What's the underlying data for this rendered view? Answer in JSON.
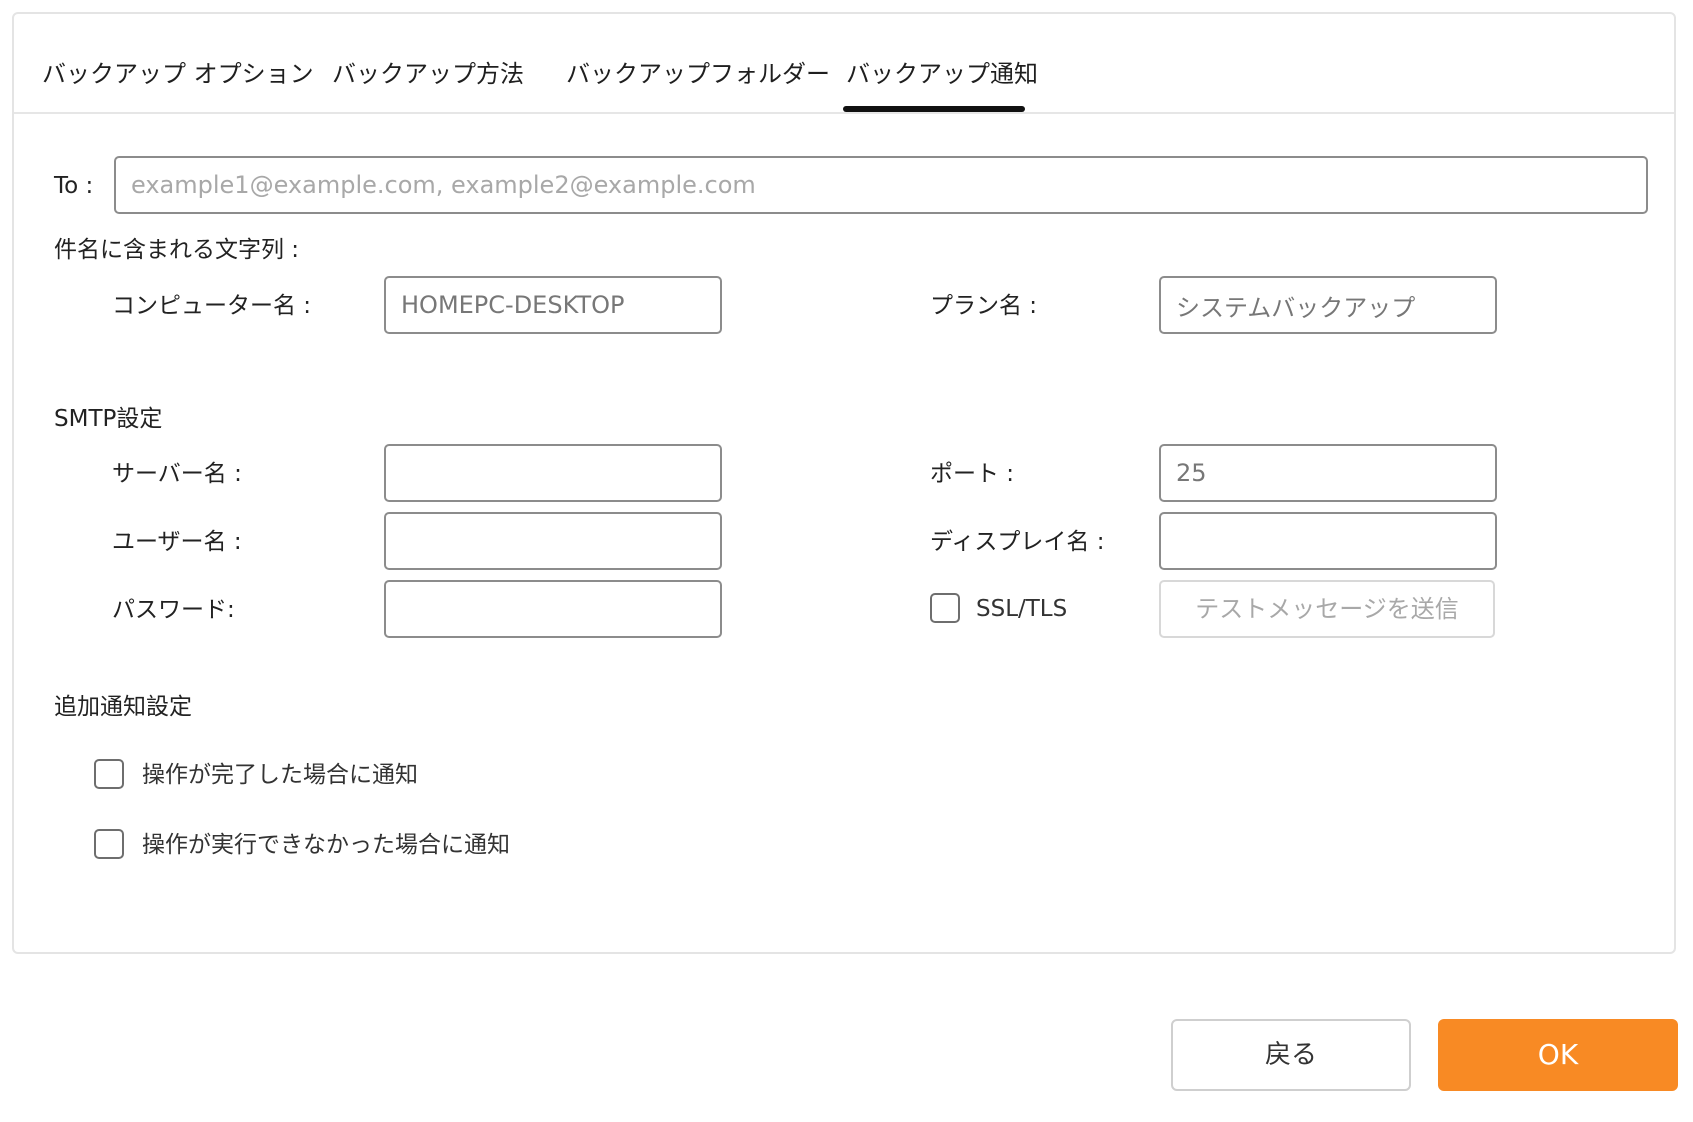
{
  "colors": {
    "accent": "#f88a24",
    "tab_underline": "#111111",
    "border": "#8c8c8c"
  },
  "tabs": [
    {
      "label": "バックアップ オプション",
      "active": false
    },
    {
      "label": "バックアップ方法",
      "active": false
    },
    {
      "label": "バックアップフォルダー",
      "active": false
    },
    {
      "label": "バックアップ通知",
      "active": true
    }
  ],
  "to": {
    "label": "To :",
    "placeholder": "example1@example.com, example2@example.com",
    "value": ""
  },
  "subject": {
    "title": "件名に含まれる文字列 :",
    "computer_name": {
      "label": "コンピューター名 :",
      "value": "HOMEPC-DESKTOP"
    },
    "plan_name": {
      "label": "プラン名 :",
      "value": "システムバックアップ"
    }
  },
  "smtp": {
    "title": "SMTP設定",
    "server": {
      "label": "サーバー名 :",
      "value": ""
    },
    "port": {
      "label": "ポート :",
      "value": "25"
    },
    "user": {
      "label": "ユーザー名 :",
      "value": ""
    },
    "display_name": {
      "label": "ディスプレイ名 :",
      "value": ""
    },
    "password": {
      "label": "パスワード:",
      "value": ""
    },
    "ssl": {
      "label": "SSL/TLS",
      "checked": false
    },
    "test_button": "テストメッセージを送信"
  },
  "additional": {
    "title": "追加通知設定",
    "notify_complete": {
      "label": "操作が完了した場合に通知",
      "checked": false
    },
    "notify_fail": {
      "label": "操作が実行できなかった場合に通知",
      "checked": false
    }
  },
  "footer": {
    "back_label": "戻る",
    "ok_label": "OK"
  }
}
